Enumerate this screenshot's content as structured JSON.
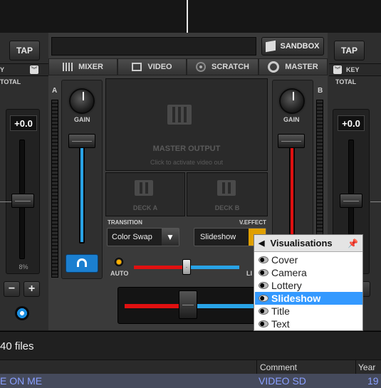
{
  "toolbar": {
    "tap_left": "TAP",
    "tap_right": "TAP",
    "sandbox": "SANDBOX"
  },
  "tabs": [
    {
      "label": "MIXER"
    },
    {
      "label": "VIDEO"
    },
    {
      "label": "SCRATCH"
    },
    {
      "label": "MASTER"
    }
  ],
  "left_deck": {
    "key_fragment": "Y",
    "total_fragment": "TOTAL",
    "pitch": "+0.0",
    "percent": "8%"
  },
  "right_deck": {
    "key": "KEY",
    "total": "TOTAL",
    "pitch": "+0.0"
  },
  "mixer": {
    "deck_a": "A",
    "deck_b": "B",
    "gain_left": "GAIN",
    "gain_right": "GAIN"
  },
  "video": {
    "master_output": "MASTER OUTPUT",
    "master_hint": "Click to activate video out",
    "deck_a": "DECK A",
    "deck_b": "DECK B",
    "transition_label": "TRANSITION",
    "transition_value": "Color Swap",
    "veffect_label": "V.EFFECT",
    "veffect_value": "Slideshow",
    "auto": "AUTO",
    "link_fragment": "LI"
  },
  "menu": {
    "title": "Visualisations",
    "items": [
      {
        "label": "Cover"
      },
      {
        "label": "Camera"
      },
      {
        "label": "Lottery"
      },
      {
        "label": "Slideshow"
      },
      {
        "label": "Title"
      },
      {
        "label": "Text"
      }
    ],
    "selected": "Slideshow"
  },
  "browser": {
    "file_count": "40 files",
    "columns": {
      "comment": "Comment",
      "year": "Year"
    },
    "row": {
      "title_fragment": "E ON ME",
      "comment": "VIDEO SD",
      "year_fragment": "19"
    }
  },
  "colors": {
    "accent_red": "#e01010",
    "accent_blue": "#29a3e6",
    "selection": "#3399ff",
    "row_text": "#8aa0ff"
  }
}
